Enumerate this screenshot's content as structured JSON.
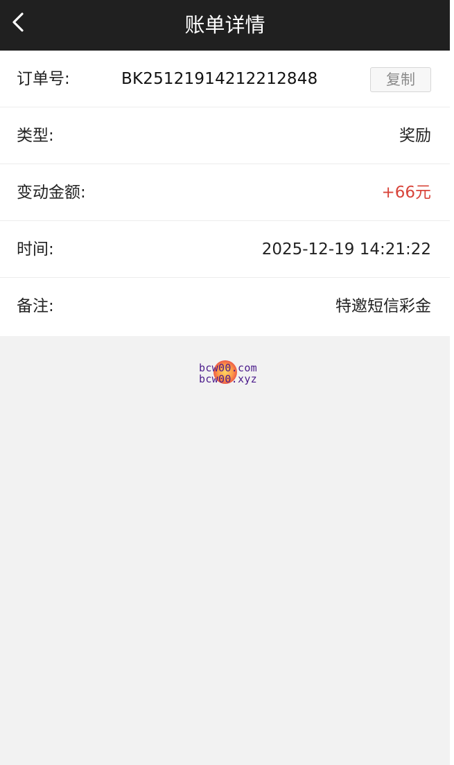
{
  "header": {
    "title": "账单详情",
    "back_icon": "chevron-left-icon"
  },
  "details": {
    "order": {
      "label": "订单号:",
      "value": "BK25121914212212848",
      "copy_label": "复制"
    },
    "type": {
      "label": "类型:",
      "value": "奖励"
    },
    "amount": {
      "label": "变动金额:",
      "value": "+66元",
      "color": "#d8443a"
    },
    "time": {
      "label": "时间:",
      "value": "2025-12-19 14:21:22"
    },
    "remark": {
      "label": "备注:",
      "value": "特邀短信彩金"
    }
  },
  "watermark": {
    "line1": "bcw00.com",
    "line2": "bcw00.xyz"
  },
  "colors": {
    "header_bg": "#202020",
    "page_bg": "#f2f2f2",
    "amount_red": "#d8443a"
  }
}
